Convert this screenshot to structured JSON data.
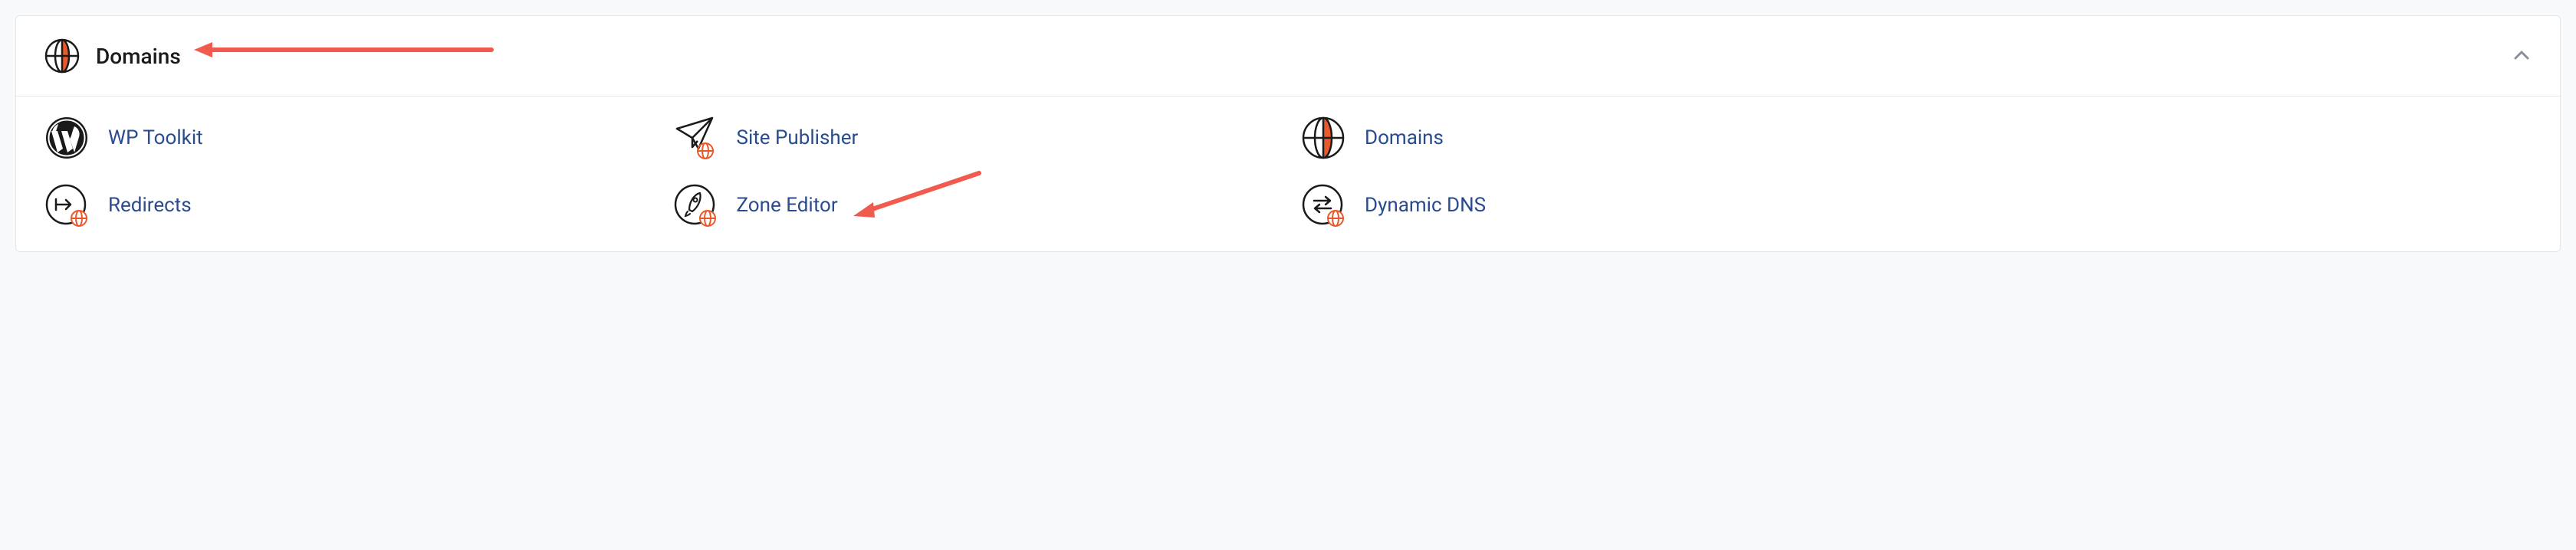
{
  "header": {
    "title": "Domains"
  },
  "items": [
    {
      "label": "WP Toolkit",
      "icon": "wordpress"
    },
    {
      "label": "Site Publisher",
      "icon": "paper-plane-globe"
    },
    {
      "label": "Domains",
      "icon": "globe"
    },
    {
      "label": "Redirects",
      "icon": "redirect-globe"
    },
    {
      "label": "Zone Editor",
      "icon": "rocket-globe"
    },
    {
      "label": "Dynamic DNS",
      "icon": "exchange-globe"
    }
  ],
  "annotations": {
    "arrow_to_header": true,
    "arrow_to_zone_editor": true
  },
  "colors": {
    "accent_orange": "#E85A2C",
    "link_blue": "#2a4b8d",
    "annotation_red": "#F05B4E"
  }
}
